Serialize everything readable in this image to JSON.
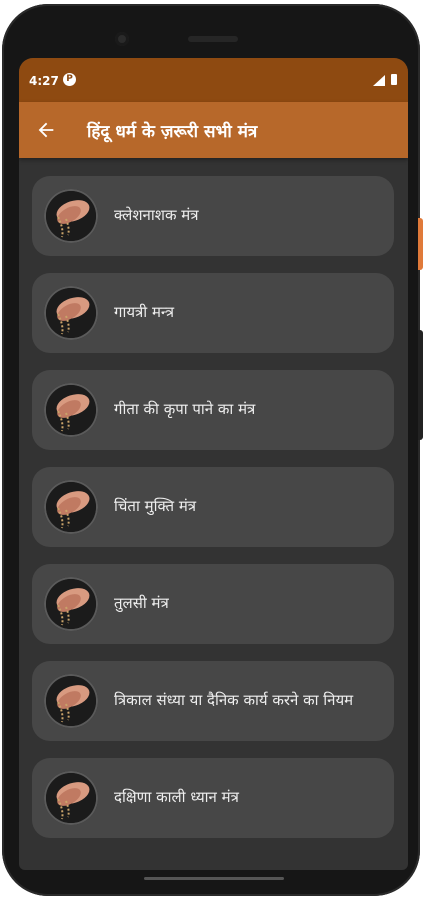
{
  "status_bar": {
    "time": "4:27",
    "notification_badge": "P",
    "color": "#8e4a11"
  },
  "app_bar": {
    "title": "हिंदू धर्म के ज़रूरी सभी मंत्र",
    "back_icon": "arrow-left-icon",
    "color": "#b7682a"
  },
  "list": {
    "items": [
      {
        "label": "क्लेशनाशक मंत्र"
      },
      {
        "label": "गायत्री मन्त्र"
      },
      {
        "label": "गीता की कृपा पाने का मंत्र"
      },
      {
        "label": "चिंता मुक्ति मंत्र"
      },
      {
        "label": "तुलसी मंत्र"
      },
      {
        "label": "त्रिकाल संध्या या दैनिक कार्य करने का नियम"
      },
      {
        "label": "दक्षिणा काली ध्यान मंत्र"
      }
    ],
    "thumbnail_icon": "praying-hands-rosary-icon"
  },
  "colors": {
    "background": "#333333",
    "card": "#474747"
  }
}
